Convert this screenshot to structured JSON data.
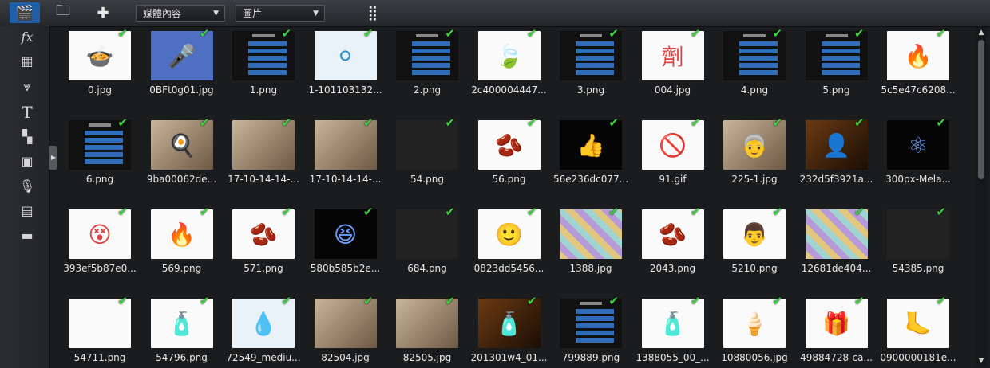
{
  "toolbar": {
    "media_dropdown": "媒體內容",
    "filter_dropdown": "圖片",
    "icons": [
      "media-library-icon",
      "import-folder-icon",
      "plugin-icon",
      "sort-grid-icon"
    ]
  },
  "sidebar": {
    "icons": [
      "fx-icon",
      "title-effect-icon",
      "particle-icon",
      "text-icon",
      "transition-icon",
      "pip-icon",
      "microphone-icon",
      "chapter-icon",
      "subtitle-icon"
    ]
  },
  "files": [
    {
      "name": "0.jpg",
      "kind": "white",
      "glyph": "🍲"
    },
    {
      "name": "0BFt0g01.jpg",
      "kind": "blue",
      "glyph": "🎤"
    },
    {
      "name": "1.png",
      "kind": "slide",
      "glyph": ""
    },
    {
      "name": "1-101103132...",
      "kind": "sky",
      "glyph": "⚪"
    },
    {
      "name": "2.png",
      "kind": "slide",
      "glyph": ""
    },
    {
      "name": "2c400004447...",
      "kind": "white",
      "glyph": "🍃"
    },
    {
      "name": "3.png",
      "kind": "slide",
      "glyph": ""
    },
    {
      "name": "004.jpg",
      "kind": "white",
      "glyph": "劑"
    },
    {
      "name": "4.png",
      "kind": "slide",
      "glyph": ""
    },
    {
      "name": "5.png",
      "kind": "slide",
      "glyph": ""
    },
    {
      "name": "5c5e47c6208...",
      "kind": "white",
      "glyph": "🔥"
    },
    {
      "name": "6.png",
      "kind": "slide",
      "glyph": ""
    },
    {
      "name": "9ba00062de...",
      "kind": "photo",
      "glyph": "🍳"
    },
    {
      "name": "17-10-14-14-...",
      "kind": "photo",
      "glyph": ""
    },
    {
      "name": "17-10-14-14-...",
      "kind": "photo",
      "glyph": ""
    },
    {
      "name": "54.png",
      "kind": "grid",
      "glyph": ""
    },
    {
      "name": "56.png",
      "kind": "white",
      "glyph": "🫘"
    },
    {
      "name": "56e236dc077...",
      "kind": "space",
      "glyph": "👍"
    },
    {
      "name": "91.gif",
      "kind": "white",
      "glyph": "🚫"
    },
    {
      "name": "225-1.jpg",
      "kind": "photo",
      "glyph": "👵"
    },
    {
      "name": "232d5f3921a...",
      "kind": "dark",
      "glyph": "👤"
    },
    {
      "name": "300px-Mela...",
      "kind": "space",
      "glyph": "⚛"
    },
    {
      "name": "393ef5b87e0...",
      "kind": "white",
      "glyph": "😵"
    },
    {
      "name": "569.png",
      "kind": "white",
      "glyph": "🔥"
    },
    {
      "name": "571.png",
      "kind": "white",
      "glyph": "🫘"
    },
    {
      "name": "580b585b2e...",
      "kind": "space",
      "glyph": "😆"
    },
    {
      "name": "684.png",
      "kind": "grid",
      "glyph": ""
    },
    {
      "name": "0823dd5456...",
      "kind": "white",
      "glyph": "🙂"
    },
    {
      "name": "1388.jpg",
      "kind": "stripe",
      "glyph": ""
    },
    {
      "name": "2043.png",
      "kind": "white",
      "glyph": "🫘"
    },
    {
      "name": "5210.png",
      "kind": "white",
      "glyph": "👨"
    },
    {
      "name": "12681de404...",
      "kind": "stripe",
      "glyph": ""
    },
    {
      "name": "54385.png",
      "kind": "grid",
      "glyph": ""
    },
    {
      "name": "54711.png",
      "kind": "white",
      "glyph": ""
    },
    {
      "name": "54796.png",
      "kind": "white",
      "glyph": "🧴"
    },
    {
      "name": "72549_mediu...",
      "kind": "sky",
      "glyph": "💧"
    },
    {
      "name": "82504.jpg",
      "kind": "photo",
      "glyph": ""
    },
    {
      "name": "82505.jpg",
      "kind": "photo",
      "glyph": ""
    },
    {
      "name": "201301w4_01...",
      "kind": "dark",
      "glyph": "🧴"
    },
    {
      "name": "799889.png",
      "kind": "slide",
      "glyph": ""
    },
    {
      "name": "1388055_00_...",
      "kind": "white",
      "glyph": "🧴"
    },
    {
      "name": "10880056.jpg",
      "kind": "white",
      "glyph": "🍦"
    },
    {
      "name": "49884728-ca...",
      "kind": "white",
      "glyph": "🎁"
    },
    {
      "name": "0900000181e...",
      "kind": "white",
      "glyph": "🦶"
    }
  ]
}
